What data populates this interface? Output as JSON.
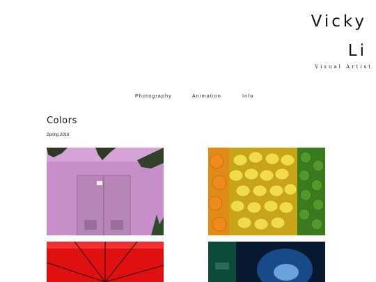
{
  "header": {
    "name_lines": [
      "Vicky",
      "Li"
    ],
    "subtitle": "Visual Artist"
  },
  "nav": {
    "items": [
      {
        "label": "Photography"
      },
      {
        "label": "Animation"
      },
      {
        "label": "Info"
      }
    ]
  },
  "gallery": {
    "title": "Colors",
    "date": "Spring 2016",
    "photos": [
      {
        "subject": "pink-wall-double-door",
        "dominant_color": "#c88ec9"
      },
      {
        "subject": "lemons-limes-oranges",
        "dominant_color": "#e8d84a"
      },
      {
        "subject": "red-umbrella",
        "dominant_color": "#e01010"
      },
      {
        "subject": "blue-lights-night",
        "dominant_color": "#1a4a8a"
      }
    ]
  },
  "colors": {
    "background": "#ffffff",
    "text": "#111111"
  }
}
